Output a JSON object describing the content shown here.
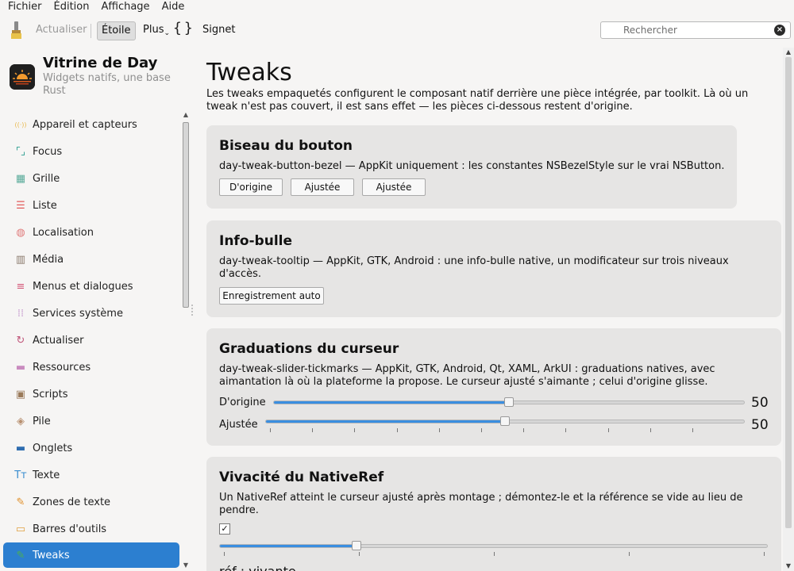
{
  "menu": [
    "Fichier",
    "Édition",
    "Affichage",
    "Aide"
  ],
  "toolbar": {
    "actualiser": "Actualiser",
    "etoile": "Étoile",
    "plus": "Plus",
    "braces": "{}",
    "signet": "Signet",
    "search_placeholder": "Rechercher"
  },
  "app": {
    "title": "Vitrine de Day",
    "subtitle": "Widgets natifs, une base Rust"
  },
  "nav": [
    {
      "label": "Appareil et capteurs",
      "icon": "sensor-icon",
      "color": "#e8b84a"
    },
    {
      "label": "Focus",
      "icon": "focus-icon",
      "color": "#2a9d8f"
    },
    {
      "label": "Grille",
      "icon": "grid-icon",
      "color": "#5aab9a"
    },
    {
      "label": "Liste",
      "icon": "list-icon",
      "color": "#e25b5b"
    },
    {
      "label": "Localisation",
      "icon": "globe-icon",
      "color": "#e07a7a"
    },
    {
      "label": "Média",
      "icon": "clapper-icon",
      "color": "#8c7b6e"
    },
    {
      "label": "Menus et dialogues",
      "icon": "menu-icon",
      "color": "#d45a7a"
    },
    {
      "label": "Services système",
      "icon": "dots-icon",
      "color": "#c9a0d0"
    },
    {
      "label": "Actualiser",
      "icon": "refresh-icon",
      "color": "#c0567a"
    },
    {
      "label": "Ressources",
      "icon": "folder-icon",
      "color": "#c98bbf"
    },
    {
      "label": "Scripts",
      "icon": "terminal-icon",
      "color": "#9a7a5a"
    },
    {
      "label": "Pile",
      "icon": "stack-icon",
      "color": "#b89070"
    },
    {
      "label": "Onglets",
      "icon": "tabs-icon",
      "color": "#2f6db0"
    },
    {
      "label": "Texte",
      "icon": "text-icon",
      "color": "#3a8ed0"
    },
    {
      "label": "Zones de texte",
      "icon": "pencil-icon",
      "color": "#e0902a"
    },
    {
      "label": "Barres d'outils",
      "icon": "toolbar-icon",
      "color": "#e0a040"
    },
    {
      "label": "Tweaks",
      "icon": "wrench-icon",
      "color": "#4caf50"
    }
  ],
  "page": {
    "title": "Tweaks",
    "description": "Les tweaks empaquetés configurent le composant natif derrière une pièce intégrée, par toolkit. Là où un tweak n'est pas couvert, il est sans effet — les pièces ci-dessous restent d'origine."
  },
  "cards": {
    "bezel": {
      "title": "Biseau du bouton",
      "desc": "day-tweak-button-bezel — AppKit uniquement : les constantes NSBezelStyle sur le vrai NSButton.",
      "buttons": [
        "D'origine",
        "Ajustée",
        "Ajustée"
      ]
    },
    "tooltip": {
      "title": "Info-bulle",
      "desc": "day-tweak-tooltip — AppKit, GTK, Android : une info-bulle native, un modificateur sur trois niveaux d'accès.",
      "button": "Enregistrement auto"
    },
    "ticks": {
      "title": "Graduations du curseur",
      "desc": "day-tweak-slider-tickmarks — AppKit, GTK, Android, Qt, XAML, ArkUI : graduations natives, avec aimantation là où la plateforme la propose. Le curseur ajusté s'aimante ; celui d'origine glisse.",
      "row1_label": "D'origine",
      "row1_value": "50",
      "row1_fraction": 0.5,
      "row2_label": "Ajustée",
      "row2_value": "50",
      "row2_fraction": 0.5
    },
    "nativeref": {
      "title": "Vivacité du NativeRef",
      "desc": "Un NativeRef atteint le curseur ajusté après montage ; démontez-le et la référence se vide au lieu de pendre.",
      "checked": "✓",
      "slider_fraction": 0.25,
      "status": "réf : vivante"
    }
  },
  "colors": {
    "accent": "#2c7fd0",
    "slider_fill": "#3a8ee0"
  }
}
